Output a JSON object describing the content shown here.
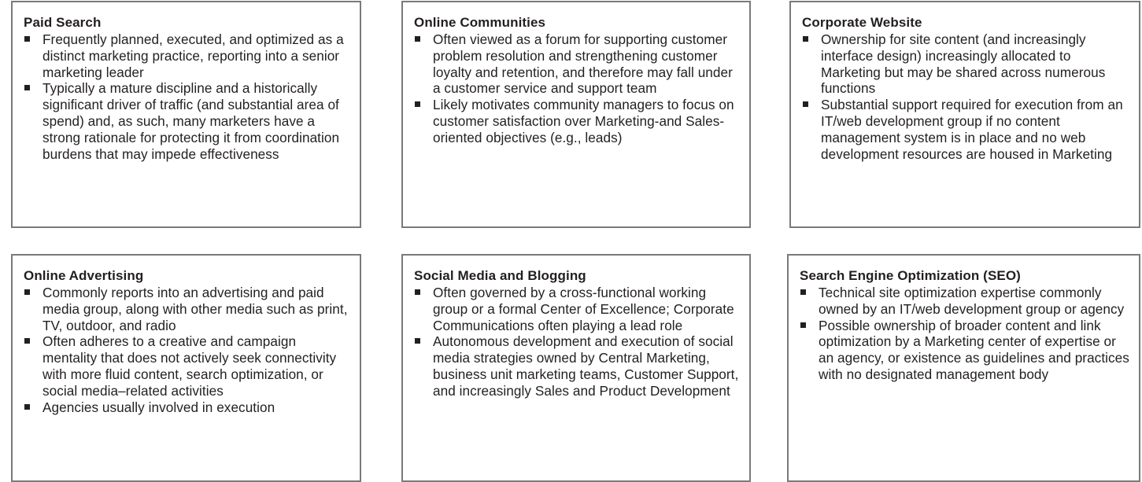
{
  "cards": [
    {
      "title": "Paid Search",
      "bullets": [
        "Frequently planned, executed, and optimized as a distinct marketing practice, reporting into a senior marketing leader",
        "Typically a mature discipline and a historically significant driver of traffic (and substantial area of spend) and, as such, many marketers have a strong rationale for protecting it from coordination burdens that may impede effectiveness"
      ]
    },
    {
      "title": "Online Communities",
      "bullets": [
        "Often viewed as a forum for supporting customer problem resolution and strengthening customer loyalty and retention, and therefore may fall under a customer service and support team",
        "Likely motivates community managers to focus on customer satisfaction over Marketing-and Sales-oriented objectives (e.g., leads)"
      ]
    },
    {
      "title": "Corporate Website",
      "bullets": [
        "Ownership for site content (and increasingly interface design) increasingly allocated to Marketing but may be shared across numerous functions",
        "Substantial support required for execution from an IT/web development group if no content management system is in place and no web development resources are housed in Marketing"
      ]
    },
    {
      "title": "Online Advertising",
      "bullets": [
        "Commonly reports into an advertising and paid media group, along with other media such as print, TV, outdoor, and radio",
        "Often adheres to a creative and campaign mentality that does not actively seek connectivity with more fluid content, search optimization, or social media–related activities",
        "Agencies usually involved in execution"
      ]
    },
    {
      "title": "Social Media and Blogging",
      "bullets": [
        "Often governed by a cross-functional working group or a formal Center of Excellence; Corporate Communications often playing a lead role",
        "Autonomous development and execution of social media strategies owned by Central Marketing, business unit marketing teams, Customer Support, and increasingly Sales and Product Development"
      ]
    },
    {
      "title": "Search Engine Optimization (SEO)",
      "bullets": [
        "Technical site optimization expertise commonly owned by an IT/web development group or agency",
        "Possible ownership of broader content and link optimization by a Marketing center of expertise or an agency, or existence as guidelines and practices with no designated management body"
      ]
    }
  ]
}
